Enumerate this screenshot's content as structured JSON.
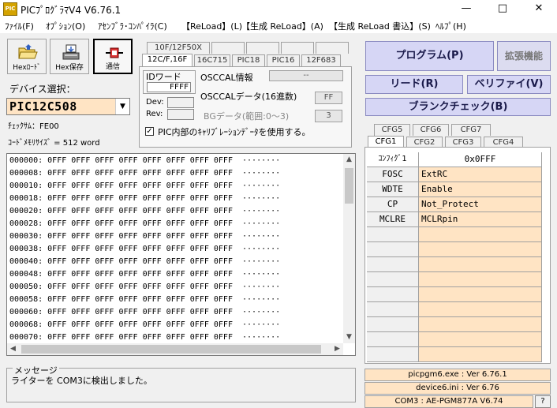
{
  "window": {
    "title": "PICﾌﾟﾛｸﾞﾗﾏV4 V6.76.1",
    "app_icon_text": "PIC",
    "minimize": "—",
    "maximize": "□",
    "close": "✕"
  },
  "menu": [
    "ﾌｧｲﾙ(F)",
    "ｵﾌﾟｼｮﾝ(O)",
    "ｱｾﾝﾌﾞﾗ･ｺﾝﾊﾟｲﾗ(C)",
    "【ReLoad】(L)",
    "【生成 ReLoad】(A)",
    "【生成 ReLoad 書込】(S)",
    "ﾍﾙﾌﾟ(H)"
  ],
  "toolbar": {
    "hex_load": "Hexﾛｰﾄﾞ",
    "hex_save": "Hex保存",
    "comm": "通信"
  },
  "device": {
    "label": "デバイス選択：",
    "selected": "PIC12C508",
    "checksum": "ﾁｪｯｸｻﾑ：FE00",
    "code_size": "ｺｰﾄﾞﾒﾓﾘｻｲｽﾞ = 512 word"
  },
  "tabs_row1": [
    "10F/12F50X",
    "",
    "",
    "",
    ""
  ],
  "tabs_row2": [
    "12C/F,16F",
    "16C715",
    "PIC18",
    "PIC16",
    "12F683"
  ],
  "idpanel": {
    "idword_label": "IDワード",
    "idword_value": "FFFF",
    "osccal_info_label": "OSCCAL情報",
    "osccal_info_value": "--",
    "osccal_data_label": "OSCCALデータ(16進数)",
    "osccal_data_value": "FF",
    "bg_data_label": "BGデータ(範囲:0〜3)",
    "bg_data_value": "3",
    "dev_label": "Dev:",
    "rev_label": "Rev:",
    "calib_check": "✓",
    "calib_label": "PIC内部のｷｬﾘﾌﾞﾚｰｼｮﾝﾃﾞｰﾀを使用する。"
  },
  "commands": {
    "program": "プログラム(P)",
    "extended": "拡張機能",
    "read": "リード(R)",
    "verify": "ベリファイ(V)",
    "blank": "ブランクチェック(B)"
  },
  "hex_rows": [
    "000000: 0FFF 0FFF 0FFF 0FFF 0FFF 0FFF 0FFF 0FFF  ········",
    "000008: 0FFF 0FFF 0FFF 0FFF 0FFF 0FFF 0FFF 0FFF  ········",
    "000010: 0FFF 0FFF 0FFF 0FFF 0FFF 0FFF 0FFF 0FFF  ········",
    "000018: 0FFF 0FFF 0FFF 0FFF 0FFF 0FFF 0FFF 0FFF  ········",
    "000020: 0FFF 0FFF 0FFF 0FFF 0FFF 0FFF 0FFF 0FFF  ········",
    "000028: 0FFF 0FFF 0FFF 0FFF 0FFF 0FFF 0FFF 0FFF  ········",
    "000030: 0FFF 0FFF 0FFF 0FFF 0FFF 0FFF 0FFF 0FFF  ········",
    "000038: 0FFF 0FFF 0FFF 0FFF 0FFF 0FFF 0FFF 0FFF  ········",
    "000040: 0FFF 0FFF 0FFF 0FFF 0FFF 0FFF 0FFF 0FFF  ········",
    "000048: 0FFF 0FFF 0FFF 0FFF 0FFF 0FFF 0FFF 0FFF  ········",
    "000050: 0FFF 0FFF 0FFF 0FFF 0FFF 0FFF 0FFF 0FFF  ········",
    "000058: 0FFF 0FFF 0FFF 0FFF 0FFF 0FFF 0FFF 0FFF  ········",
    "000060: 0FFF 0FFF 0FFF 0FFF 0FFF 0FFF 0FFF 0FFF  ········",
    "000068: 0FFF 0FFF 0FFF 0FFF 0FFF 0FFF 0FFF 0FFF  ········",
    "000070: 0FFF 0FFF 0FFF 0FFF 0FFF 0FFF 0FFF 0FFF  ········"
  ],
  "cfg_tabs_row1": [
    "CFG5",
    "CFG6",
    "CFG7"
  ],
  "cfg_tabs_row2": [
    "CFG1",
    "CFG2",
    "CFG3",
    "CFG4"
  ],
  "cfg_table": {
    "header_name": "ｺﾝﾌｨｸﾞ1",
    "header_value": "0x0FFF",
    "rows": [
      {
        "name": "FOSC",
        "value": "ExtRC"
      },
      {
        "name": "WDTE",
        "value": "Enable"
      },
      {
        "name": "CP",
        "value": "Not_Protect"
      },
      {
        "name": "MCLRE",
        "value": "MCLRpin"
      }
    ]
  },
  "message": {
    "label": "メッセージ",
    "text": "ライターを COM3に検出しました。"
  },
  "status": {
    "exe_ver": "picpgm6.exe : Ver 6.76.1",
    "ini_ver": "device6.ini : Ver 6.76",
    "com": "COM3 : AE-PGM877A V6.74",
    "help": "?"
  },
  "colors": {
    "cell_value_bg": "#ffe4c4",
    "command_button_bg": "#d6d6f5"
  }
}
